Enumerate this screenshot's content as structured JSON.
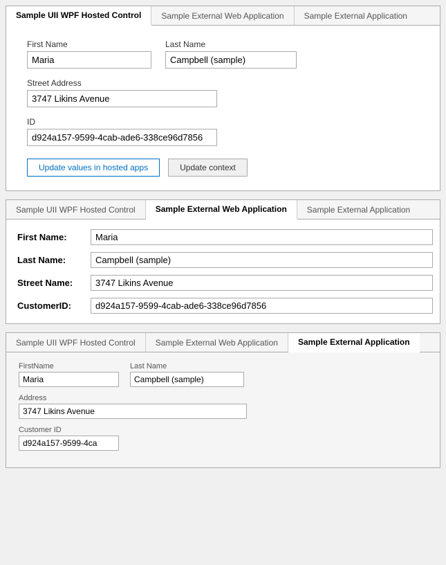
{
  "panel1": {
    "tabs": [
      {
        "label": "Sample UII WPF Hosted Control",
        "active": true
      },
      {
        "label": "Sample External Web Application",
        "active": false
      },
      {
        "label": "Sample External Application",
        "active": false
      }
    ],
    "fields": {
      "first_name_label": "First Name",
      "first_name_value": "Maria",
      "last_name_label": "Last Name",
      "last_name_value": "Campbell (sample)",
      "street_label": "Street Address",
      "street_value": "3747 Likins Avenue",
      "id_label": "ID",
      "id_value": "d924a157-9599-4cab-ade6-338ce96d7856"
    },
    "buttons": {
      "update_hosted": "Update values in hosted apps",
      "update_context": "Update context"
    }
  },
  "panel2": {
    "tabs": [
      {
        "label": "Sample UII WPF Hosted Control",
        "active": false
      },
      {
        "label": "Sample External Web Application",
        "active": true
      },
      {
        "label": "Sample External Application",
        "active": false
      }
    ],
    "rows": [
      {
        "label": "First Name:",
        "value": "Maria"
      },
      {
        "label": "Last Name:",
        "value": "Campbell (sample)"
      },
      {
        "label": "Street Name:",
        "value": "3747 Likins Avenue"
      },
      {
        "label": "CustomerID:",
        "value": "d924a157-9599-4cab-ade6-338ce96d7856"
      }
    ]
  },
  "panel3": {
    "tabs": [
      {
        "label": "Sample UII WPF Hosted Control",
        "active": false
      },
      {
        "label": "Sample External Web Application",
        "active": false
      },
      {
        "label": "Sample External Application",
        "active": true
      }
    ],
    "fields": {
      "first_name_label": "FirstName",
      "first_name_value": "Maria",
      "last_name_label": "Last Name",
      "last_name_value": "Campbell (sample)",
      "address_label": "Address",
      "address_value": "3747 Likins Avenue",
      "custid_label": "Customer ID",
      "custid_value": "d924a157-9599-4ca"
    }
  }
}
